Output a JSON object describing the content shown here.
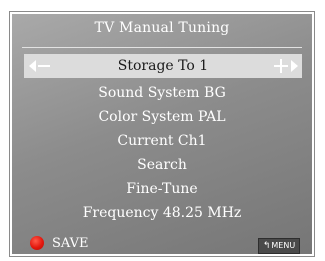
{
  "title": "TV Manual Tuning",
  "selected_item": {
    "label": "Storage To 1"
  },
  "menu_items": [
    "Sound System BG",
    "Color System PAL",
    "Current Ch1",
    "Search",
    "Fine-Tune",
    "Frequency 48.25 MHz"
  ],
  "footer": {
    "save_label": "SAVE",
    "save_dot_color": "#e3170d",
    "menu_label": "MENU",
    "menu_icon": "back-arrow-icon"
  }
}
